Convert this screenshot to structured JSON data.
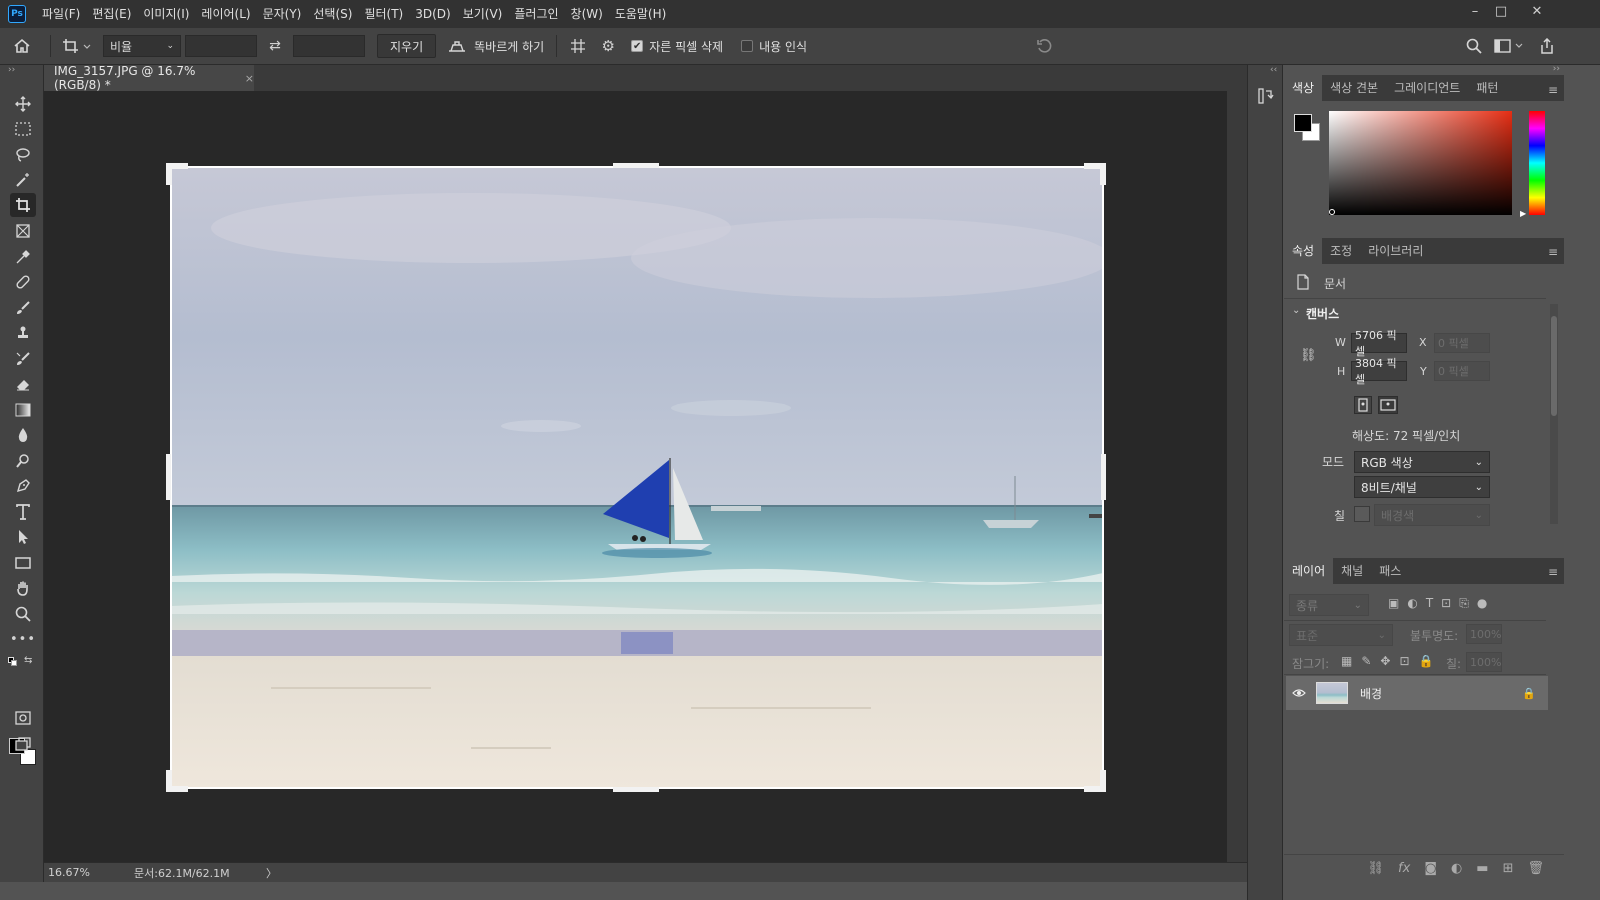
{
  "app": {
    "logo": "Ps"
  },
  "menu": [
    "파일(F)",
    "편집(E)",
    "이미지(I)",
    "레이어(L)",
    "문자(Y)",
    "선택(S)",
    "필터(T)",
    "3D(D)",
    "보기(V)",
    "플러그인",
    "창(W)",
    "도움말(H)"
  ],
  "window_controls": {
    "minimize": "–",
    "maximize": "□",
    "close": "✕"
  },
  "options": {
    "ratio_select": "비율",
    "swap_icon": "⇄",
    "clear_button": "지우기",
    "straighten_label": "똑바르게 하기",
    "delete_cropped_label": "자른 픽셀 삭제",
    "delete_cropped_checked": true,
    "content_aware_label": "내용 인식",
    "content_aware_checked": false
  },
  "document": {
    "tab_title": "IMG_3157.JPG @ 16.7% (RGB/8) *",
    "close": "×"
  },
  "status": {
    "zoom": "16.67%",
    "doc_size": "문서:62.1M/62.1M",
    "arrow": "〉"
  },
  "color_panel": {
    "tabs": [
      "색상",
      "색상 견본",
      "그레이디언트",
      "패턴"
    ],
    "active_tab": 0,
    "foreground": "#000000",
    "background": "#ffffff"
  },
  "properties_panel": {
    "tabs": [
      "속성",
      "조정",
      "라이브러리"
    ],
    "active_tab": 0,
    "doc_label": "문서",
    "section_title": "캔버스",
    "w_label": "W",
    "w_value": "5706 픽셀",
    "h_label": "H",
    "h_value": "3804 픽셀",
    "x_label": "X",
    "x_value": "0 픽셀",
    "y_label": "Y",
    "y_value": "0 픽셀",
    "resolution": "해상도: 72 픽셀/인치",
    "mode_label": "모드",
    "mode_value": "RGB 색상",
    "depth_value": "8비트/채널",
    "fill_label": "칠",
    "fill_value": "배경색"
  },
  "layers_panel": {
    "tabs": [
      "레이어",
      "채널",
      "패스"
    ],
    "active_tab": 0,
    "filter_placeholder": "종류",
    "blend_mode": "표준",
    "opacity_label": "불투명도:",
    "opacity_value": "100%",
    "lock_label": "잠그기:",
    "fill_label": "칠:",
    "fill_value": "100%",
    "layers": [
      {
        "name": "배경",
        "visible": true,
        "locked": true
      }
    ],
    "footer_icons": [
      "link-icon",
      "fx-icon",
      "mask-icon",
      "adjustment-icon",
      "folder-icon",
      "new-layer-icon",
      "trash-icon"
    ]
  },
  "colors": {
    "accent": "#31a8ff",
    "menubar": "#323232",
    "panel": "#535353",
    "canvas_bg": "#282828",
    "sail": "#1f3fb0"
  }
}
